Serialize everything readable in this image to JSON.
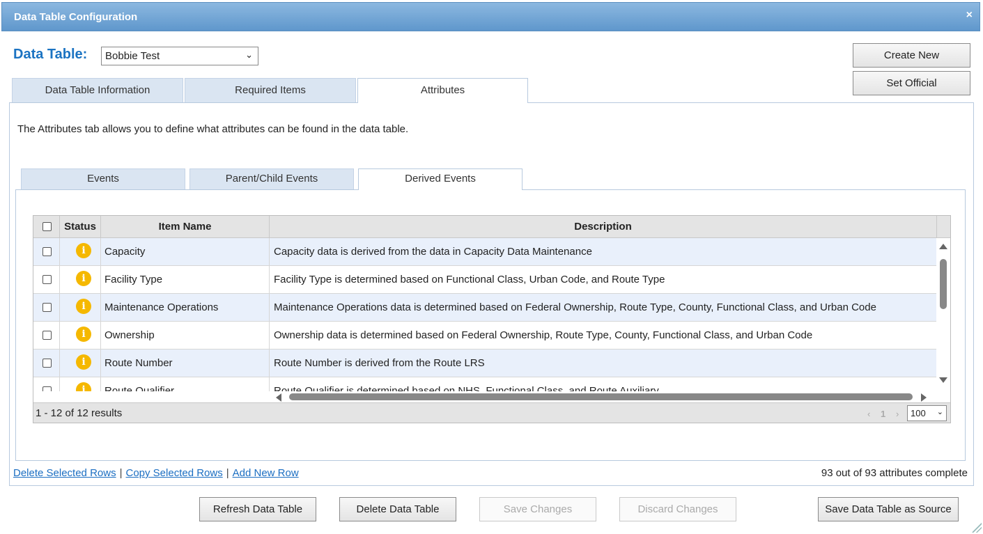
{
  "window": {
    "title": "Data Table Configuration",
    "close_glyph": "×"
  },
  "data_table": {
    "label": "Data Table:",
    "selected": "Bobbie Test"
  },
  "side_buttons": {
    "create_new": "Create New",
    "set_official": "Set Official"
  },
  "tabs": [
    {
      "label": "Data Table Information",
      "active": false
    },
    {
      "label": "Required Items",
      "active": false
    },
    {
      "label": "Attributes",
      "active": true
    }
  ],
  "attributes": {
    "description": "The Attributes tab allows you to define what attributes can be found in the data table.",
    "subtabs": [
      {
        "label": "Events",
        "active": false
      },
      {
        "label": "Parent/Child Events",
        "active": false
      },
      {
        "label": "Derived Events",
        "active": true
      }
    ]
  },
  "grid": {
    "columns": {
      "status": "Status",
      "item_name": "Item Name",
      "description": "Description"
    },
    "rows": [
      {
        "item": "Capacity",
        "description": "Capacity data is derived from the data in Capacity Data Maintenance",
        "status_icon": "info-icon"
      },
      {
        "item": "Facility Type",
        "description": "Facility Type is determined based on Functional Class, Urban Code, and Route Type",
        "status_icon": "info-icon"
      },
      {
        "item": "Maintenance Operations",
        "description": "Maintenance Operations data is determined based on Federal Ownership, Route Type, County, Functional Class, and Urban Code",
        "status_icon": "info-icon"
      },
      {
        "item": "Ownership",
        "description": "Ownership data is determined based on Federal Ownership, Route Type, County, Functional Class, and Urban Code",
        "status_icon": "info-icon"
      },
      {
        "item": "Route Number",
        "description": "Route Number is derived from the Route LRS",
        "status_icon": "info-icon"
      },
      {
        "item": "Route Qualifier",
        "description": "Route Qualifier is determined based on NHS, Functional Class, and Route Auxiliary",
        "status_icon": "info-icon"
      }
    ],
    "pager": {
      "results": "1 - 12 of 12 results",
      "prev": "‹",
      "page": "1",
      "next": "›",
      "page_size": "100"
    }
  },
  "footer_links": {
    "delete_rows": "Delete Selected Rows",
    "copy_rows": "Copy Selected Rows",
    "add_row": "Add New Row",
    "separator": "|"
  },
  "completion": "93 out of 93 attributes complete",
  "bottom_buttons": {
    "refresh": "Refresh Data Table",
    "delete": "Delete Data Table",
    "save": "Save Changes",
    "discard": "Discard Changes",
    "save_source": "Save Data Table as Source"
  },
  "colors": {
    "title_bar": "#6fa3d4",
    "label_blue": "#1b73c2",
    "info_icon": "#f5b800",
    "alt_row": "#e9f0fb",
    "link": "#1b6ec2"
  }
}
